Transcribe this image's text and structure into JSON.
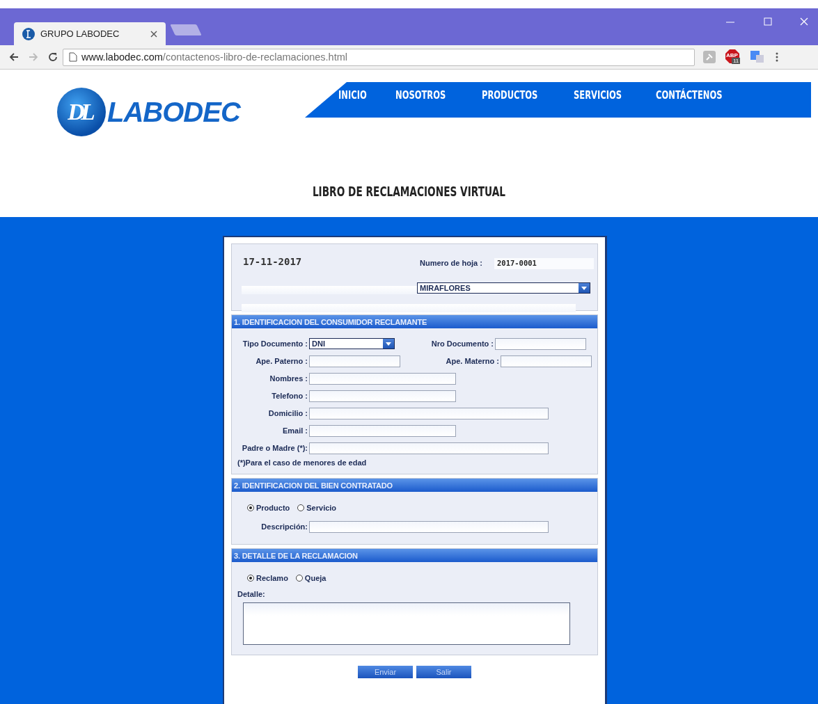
{
  "browser": {
    "tab_title": "GRUPO LABODEC",
    "url_host": "www.labodec.com",
    "url_path": "/contactenos-libro-de-reclamaciones.html",
    "abp_label": "ABP",
    "abp_count": "11"
  },
  "site": {
    "logo_mark": "DL",
    "logo_text": "LABODEC",
    "nav": [
      {
        "label": "INICIO"
      },
      {
        "label": "NOSOTROS"
      },
      {
        "label": "PRODUCTOS"
      },
      {
        "label": "SERVICIOS"
      },
      {
        "label": "CONTÁCTENOS"
      }
    ],
    "page_title": "LIBRO DE RECLAMACIONES VIRTUAL"
  },
  "form": {
    "date": "17-11-2017",
    "sheet_label": "Numero de hoja :",
    "sheet_number": "2017-0001",
    "branch": "MIRAFLORES",
    "sections": [
      {
        "heading": "1. IDENTIFICACION DEL CONSUMIDOR RECLAMANTE",
        "rows": [
          [
            {
              "label": "Tipo Documento :",
              "kind": "select",
              "value": "DNI"
            },
            {
              "label": "Nro Documento :",
              "kind": "short"
            }
          ],
          [
            {
              "label": "Ape. Paterno :",
              "kind": "short"
            },
            {
              "label": "Ape. Materno :",
              "kind": "short"
            }
          ],
          [
            {
              "label": "Nombres :",
              "kind": "medium"
            }
          ],
          [
            {
              "label": "Telefono :",
              "kind": "medium"
            }
          ],
          [
            {
              "label": "Domicilio :",
              "kind": "long"
            }
          ],
          [
            {
              "label": "Email :",
              "kind": "medium"
            }
          ],
          [
            {
              "label": "Padre o Madre (*):",
              "kind": "long"
            }
          ]
        ],
        "note": "(*)Para el caso de menores de edad"
      },
      {
        "heading": "2. IDENTIFICACION DEL BIEN CONTRATADO",
        "radios": [
          {
            "label": "Producto",
            "selected": true
          },
          {
            "label": "Servicio",
            "selected": false
          }
        ],
        "rows": [
          [
            {
              "label": "Descripción:",
              "kind": "long"
            }
          ]
        ]
      },
      {
        "heading": "3. DETALLE DE LA RECLAMACION",
        "radios": [
          {
            "label": "Reclamo",
            "selected": true
          },
          {
            "label": "Queja",
            "selected": false
          }
        ],
        "textarea_label": "Detalle:"
      }
    ],
    "buttons": [
      {
        "label": "Enviar"
      },
      {
        "label": "Salir"
      }
    ]
  }
}
